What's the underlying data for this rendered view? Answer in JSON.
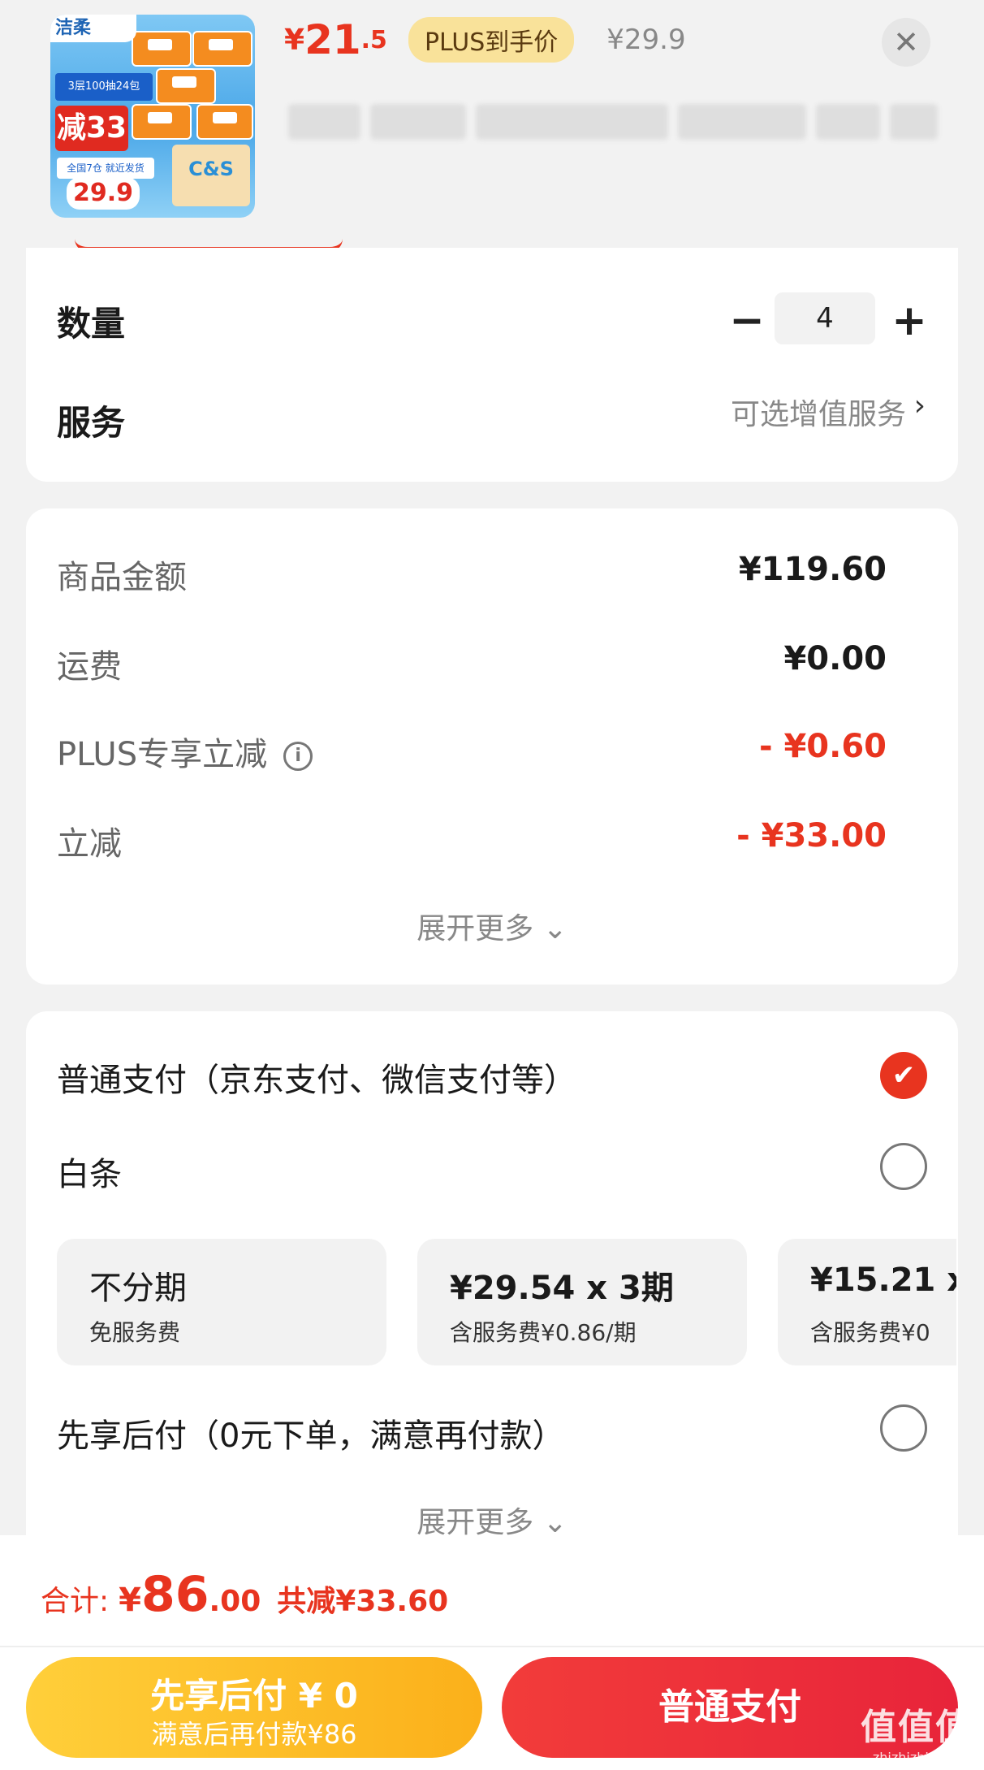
{
  "header": {
    "product_brand_text": "洁柔",
    "product_badge_text": "减33",
    "product_badge_price": "29.9",
    "product_pack_text": "C&S",
    "price_currency": "¥",
    "price_integer": "21",
    "price_decimal": ".5",
    "plus_tag": "PLUS到手价",
    "original_price": "¥29.9",
    "close_icon": "close-icon"
  },
  "order_options": {
    "quantity_label": "数量",
    "quantity_value": "4",
    "minus_symbol": "−",
    "plus_symbol": "+",
    "service_label": "服务",
    "service_value": "可选增值服务",
    "service_arrow": "›"
  },
  "price_details": {
    "rows": [
      {
        "label": "商品金额",
        "value": "¥119.60"
      },
      {
        "label": "运费",
        "value": "¥0.00"
      },
      {
        "label": "PLUS专享立减",
        "value": "- ¥0.60"
      },
      {
        "label": "立减",
        "value": "- ¥33.00"
      }
    ],
    "info_icon": "i",
    "expand_more": "展开更多 ⌄"
  },
  "payment": {
    "normal_pay_label": "普通支付（京东支付、微信支付等）",
    "normal_pay_selected": true,
    "check_glyph": "✔",
    "baitiao_label": "白条",
    "installments": [
      {
        "title": "不分期",
        "sub": "免服务费"
      },
      {
        "title": "¥29.54 x 3期",
        "sub": "含服务费¥0.86/期"
      },
      {
        "title": "¥15.21 x",
        "sub": "含服务费¥0"
      }
    ],
    "pay_later_label": "先享后付（0元下单，满意再付款）",
    "expand_more": "展开更多 ⌄"
  },
  "footer": {
    "total_label": "合计:",
    "total_currency": "¥",
    "total_integer": "86",
    "total_decimal": ".00",
    "total_saved": "共减¥33.60",
    "pay_later_button_title": "先享后付 ¥ 0",
    "pay_later_button_sub": "满意后再付款¥86",
    "normal_pay_button": "普通支付",
    "watermark_title": "值值值",
    "watermark_url": "zhizhizhi.com"
  },
  "colors": {
    "accent_red": "#e8341f",
    "plus_gold": "#f9e29a",
    "pay_later_yellow": "#fbb01a"
  }
}
